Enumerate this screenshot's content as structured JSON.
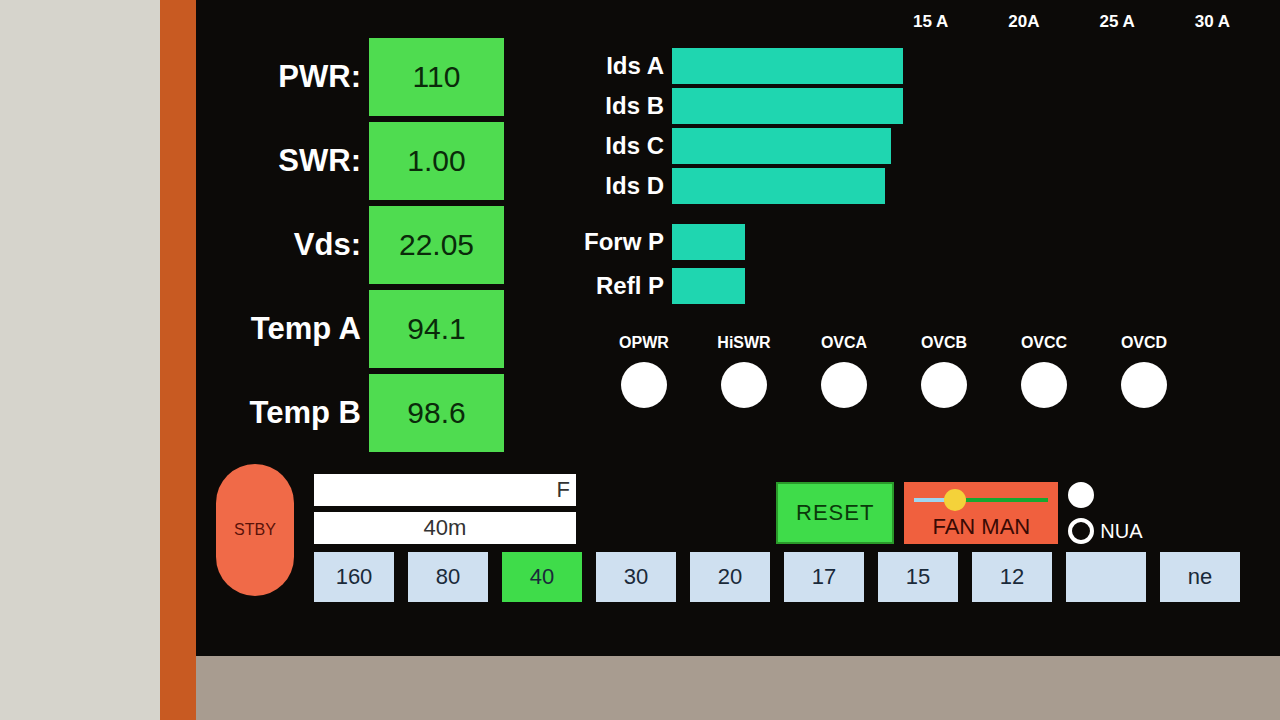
{
  "scale": [
    "15 A",
    "20A",
    "25 A",
    "30 A"
  ],
  "readings": [
    {
      "label": "PWR:",
      "value": "110"
    },
    {
      "label": "SWR:",
      "value": "1.00"
    },
    {
      "label": "Vds:",
      "value": "22.05"
    },
    {
      "label": "Temp A",
      "value": "94.1"
    },
    {
      "label": "Temp B",
      "value": "98.6"
    }
  ],
  "current_bars": [
    {
      "label": "Ids A",
      "level": 0.38
    },
    {
      "label": "Ids B",
      "level": 0.38
    },
    {
      "label": "Ids C",
      "level": 0.36
    },
    {
      "label": "Ids D",
      "level": 0.35
    }
  ],
  "power_bars": [
    {
      "label": "Forw P",
      "level": 0.12
    },
    {
      "label": "Refl P",
      "level": 0.12
    }
  ],
  "indicators": [
    {
      "label": "OPWR",
      "on": false
    },
    {
      "label": "HiSWR",
      "on": false
    },
    {
      "label": "OVCA",
      "on": false
    },
    {
      "label": "OVCB",
      "on": false
    },
    {
      "label": "OVCC",
      "on": false
    },
    {
      "label": "OVCD",
      "on": false
    }
  ],
  "standby_button": "STBY",
  "display_fields": [
    "F",
    "40m"
  ],
  "reset_button": "RESET",
  "fan": {
    "label": "FAN MAN",
    "level": 0.3
  },
  "modes": [
    {
      "label": "",
      "selected": true
    },
    {
      "label": "NUA",
      "selected": false
    }
  ],
  "bands": [
    {
      "label": "160",
      "selected": false
    },
    {
      "label": "80",
      "selected": false
    },
    {
      "label": "40",
      "selected": true
    },
    {
      "label": "30",
      "selected": false
    },
    {
      "label": "20",
      "selected": false
    },
    {
      "label": "17",
      "selected": false
    },
    {
      "label": "15",
      "selected": false
    },
    {
      "label": "12",
      "selected": false
    },
    {
      "label": "",
      "selected": false
    },
    {
      "label": "ne",
      "selected": false
    }
  ]
}
